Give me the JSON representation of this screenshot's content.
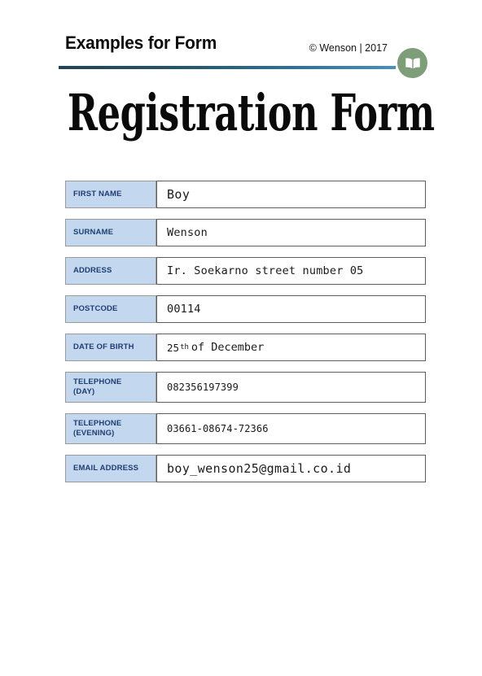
{
  "header": {
    "brand_title": "Examples for Form",
    "copyright": "© Wenson | 2017",
    "logo_icon": "open-book-icon",
    "rule_color_start": "#1f4457",
    "rule_color_end": "#4791bd",
    "logo_bg": "#7d9e79"
  },
  "document": {
    "title": "Registration Form",
    "label_bg": "#c3d8ef",
    "label_text_color": "#1f3d73"
  },
  "form": {
    "rows": [
      {
        "label_line1": "FIRST NAME",
        "label_line2": "",
        "value": "Boy"
      },
      {
        "label_line1": "SURNAME",
        "label_line2": "",
        "value": "Wenson"
      },
      {
        "label_line1": "ADDRESS",
        "label_line2": "",
        "value": "Ir. Soekarno street number 05"
      },
      {
        "label_line1": "POSTCODE",
        "label_line2": "",
        "value": "00114"
      },
      {
        "label_line1": "DATE OF BIRTH",
        "label_line2": "",
        "value_day": "25",
        "value_ordinal": "th",
        "value_rest": "of December"
      },
      {
        "label_line1": "TELEPHONE",
        "label_line2": "(DAY)",
        "value": "082356197399"
      },
      {
        "label_line1": "TELEPHONE",
        "label_line2": "(EVENING)",
        "value": "03661-08674-72366"
      },
      {
        "label_line1": "EMAIL ADDRESS",
        "label_line2": "",
        "value": "boy_wenson25@gmail.co.id"
      }
    ]
  }
}
